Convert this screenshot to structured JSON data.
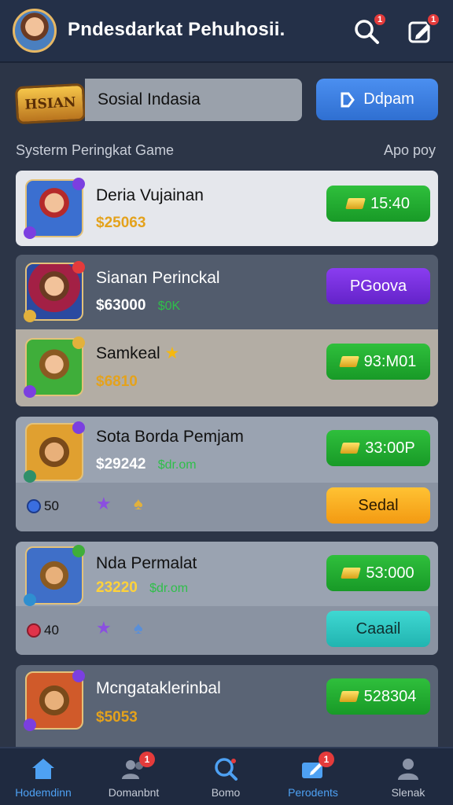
{
  "header": {
    "title": "Pndesdarkat Pehuhosii.",
    "search_badge": "1",
    "edit_badge": "1"
  },
  "search": {
    "logo_text": "HSIAN",
    "value": "Sosial Indasia",
    "button_label": "Ddpam"
  },
  "section": {
    "title": "Systerm Peringkat Game",
    "link": "Apo poy"
  },
  "games": [
    {
      "name": "Deria Vujainan",
      "sub": "$25063",
      "sub_green": "",
      "action": "15:40"
    },
    {
      "name": "Sianan Perinckal",
      "sub": "$63000",
      "sub_green": "$0K",
      "action": "PGoova"
    },
    {
      "name": "Samkeal",
      "sub": "$6810",
      "sub_green": "",
      "action": "93:M01"
    },
    {
      "name": "Sota Borda Pemjam",
      "sub": "$29242",
      "sub_green": "$dr.om",
      "action": "33:00P"
    },
    {
      "name": "Nda Permalat",
      "sub": "23220",
      "sub_green": "$dr.om",
      "action": "53:000"
    },
    {
      "name": "Mcngataklerinbal",
      "sub": "$5053",
      "sub_green": "",
      "action": "528304"
    }
  ],
  "extra_rows": [
    {
      "stat": "50",
      "action": "Sedal"
    },
    {
      "stat": "40",
      "action": "Caaail"
    }
  ],
  "nav": [
    {
      "label": "Hodemdinn",
      "badge": ""
    },
    {
      "label": "Domanbnt",
      "badge": "1"
    },
    {
      "label": "Bomo",
      "badge": ""
    },
    {
      "label": "Perodents",
      "badge": "1"
    },
    {
      "label": "Slenak",
      "badge": ""
    }
  ],
  "colors": {
    "background": "#2c3547",
    "header": "#243048",
    "primary_blue": "#2f6fd1",
    "green": "#1fae30",
    "purple": "#6f2bd6",
    "orange": "#f5a516",
    "teal": "#2bc4bf",
    "gold": "#e4a21c",
    "badge_red": "#e43b3b"
  }
}
